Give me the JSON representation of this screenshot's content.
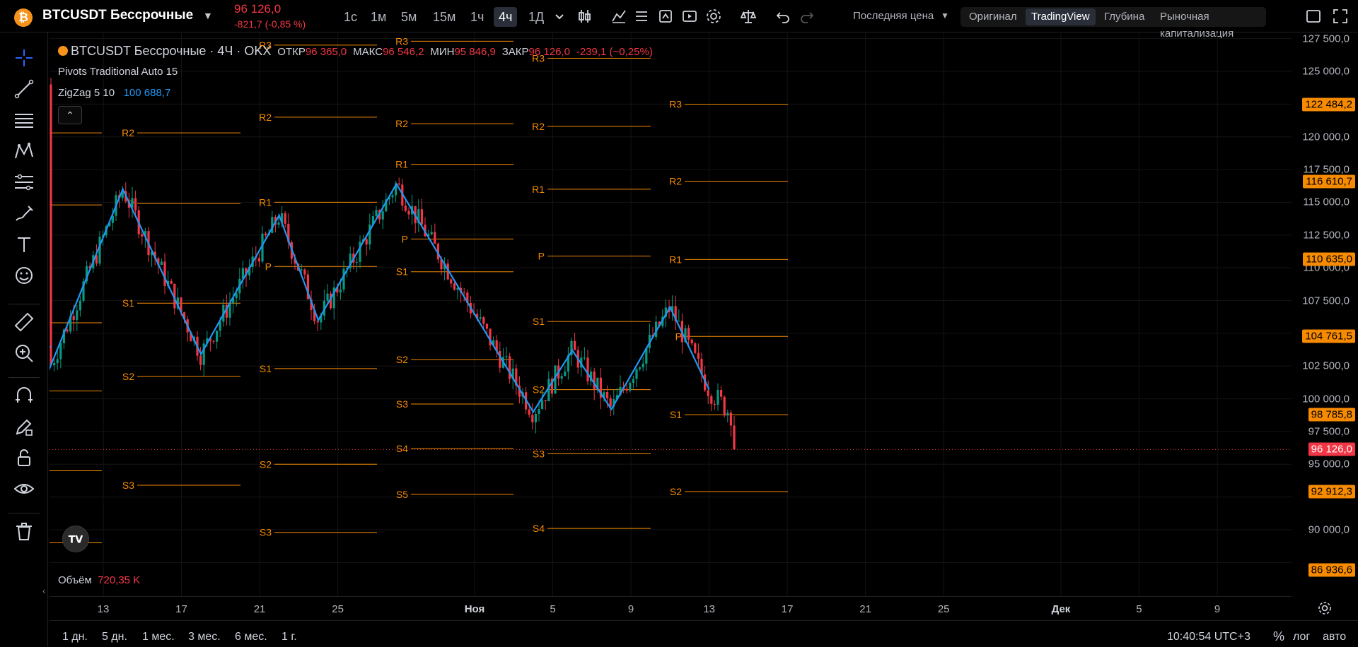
{
  "header": {
    "coin_glyph": "₿",
    "symbol": "BTCUSDT Бессрочные",
    "last_price": "96 126,0",
    "change": "-821,7 (-0,85 %)",
    "timeframes": [
      "1с",
      "1м",
      "5м",
      "15м",
      "1ч",
      "4ч",
      "1Д"
    ],
    "active_timeframe": "4ч",
    "price_type": "Последняя цена",
    "views": [
      "Оригинал",
      "TradingView",
      "Глубина",
      "Рыночная капитализация"
    ],
    "active_view": "TradingView"
  },
  "legend": {
    "symbol_line": "BTCUSDT Бессрочные · 4Ч · OKX",
    "open_label": "ОТКР",
    "open": "96 365,0",
    "high_label": "МАКС",
    "high": "96 546,2",
    "low_label": "МИН",
    "low": "95 846,9",
    "close_label": "ЗАКР",
    "close": "96 126,0",
    "change": "-239,1 (−0,25%)",
    "pivots_name": "Pivots Traditional Auto 15",
    "zigzag_name": "ZigZag 5 10",
    "zigzag_value": "100 688,7",
    "volume_label": "Объём",
    "volume_value": "720,35 K"
  },
  "price_axis": {
    "labels": [
      "127 500,0",
      "125 000,0",
      "120 000,0",
      "117 500,0",
      "115 000,0",
      "112 500,0",
      "110 000,0",
      "107 500,0",
      "102 500,0",
      "100 000,0",
      "97 500,0",
      "95 000,0",
      "90 000,0"
    ],
    "tags": [
      {
        "text": "122 484,2",
        "kind": "orange"
      },
      {
        "text": "116 610,7",
        "kind": "orange"
      },
      {
        "text": "110 635,0",
        "kind": "orange"
      },
      {
        "text": "104 761,5",
        "kind": "orange"
      },
      {
        "text": "98 785,8",
        "kind": "orange"
      },
      {
        "text": "96 126,0",
        "kind": "red"
      },
      {
        "text": "92 912,3",
        "kind": "orange"
      },
      {
        "text": "86 936,6",
        "kind": "orange"
      }
    ]
  },
  "time_axis": {
    "labels": [
      "13",
      "17",
      "21",
      "25",
      "Ноя",
      "5",
      "9",
      "13",
      "17",
      "21",
      "25",
      "Дек",
      "5",
      "9"
    ]
  },
  "bottom": {
    "ranges": [
      "1 дн.",
      "5 дн.",
      "1 мес.",
      "3 мес.",
      "6 мес.",
      "1 г."
    ],
    "clock": "10:40:54 UTC+3",
    "percent": "%",
    "log": "лог",
    "auto": "авто"
  },
  "pivots": {
    "labels": [
      "R3",
      "R2",
      "R1",
      "P",
      "S1",
      "S2",
      "S3",
      "S4",
      "S5"
    ]
  },
  "chart_data": {
    "type": "candlestick",
    "title": "BTCUSDT Бессрочные · 4Ч · OKX",
    "ylim": [
      86000,
      128500
    ],
    "series": [
      {
        "name": "ZigZag 5 10",
        "points": [
          [
            "10-09",
            103400
          ],
          [
            "10-10",
            101400
          ],
          [
            "10-14",
            116000
          ],
          [
            "10-18",
            103400
          ],
          [
            "10-22",
            114000
          ],
          [
            "10-24",
            106000
          ],
          [
            "10-28",
            116400
          ],
          [
            "11-04",
            99000
          ],
          [
            "11-06",
            103700
          ],
          [
            "11-08",
            99200
          ],
          [
            "11-11",
            107000
          ],
          [
            "11-13",
            100700
          ]
        ]
      }
    ],
    "pivot_levels": [
      {
        "period": "4",
        "R3": 127000,
        "R2": 120300,
        "R1": 114800,
        "P": 114600,
        "S1": 101800,
        "S2": 95000,
        "S3": 89800,
        "S4": 89800
      },
      {
        "period": "5",
        "R2": 121500,
        "R1": 114900,
        "P": 110100,
        "S1": 102300,
        "S2": 96100,
        "S3": 90300
      },
      {
        "period": "6",
        "R3": 127000,
        "R2": 121000,
        "R1": 117900,
        "P": 112300,
        "S1": 109400,
        "S2": 103000,
        "S3": 99500,
        "S4": 96100,
        "S5": 92600
      },
      {
        "period": "7",
        "R3": 126000,
        "R2": 120800,
        "R1": 115900,
        "P": 110900,
        "S1": 105900,
        "S2": 100800,
        "S3": 95900,
        "S4": 90100
      },
      {
        "period": "8",
        "R3": 122484.2,
        "R2": 116610.7,
        "R1": 110635.0,
        "P": 104761.5,
        "S1": 98785.8,
        "S2": 92912.3,
        "S3": 86936.6
      }
    ],
    "last": {
      "open": 96365.0,
      "high": 96546.2,
      "low": 95846.9,
      "close": 96126.0
    }
  }
}
